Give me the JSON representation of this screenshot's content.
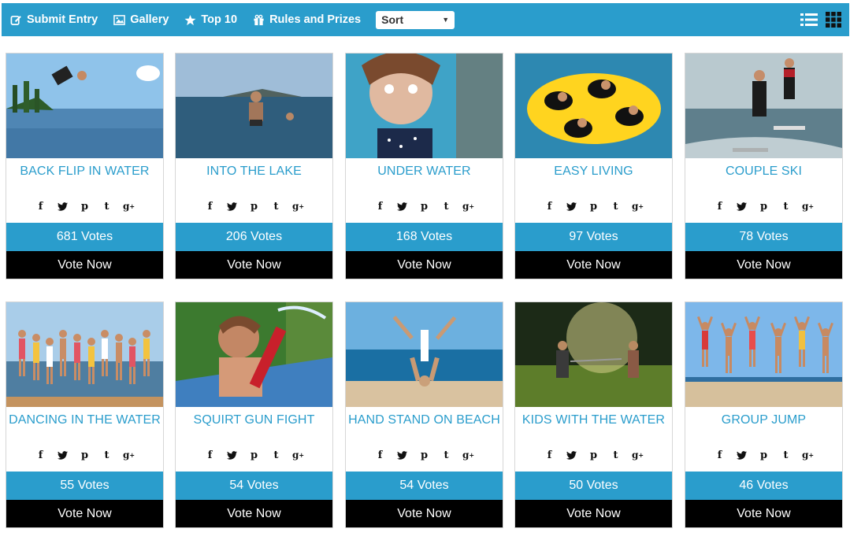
{
  "toolbar": {
    "submit_entry": "Submit Entry",
    "gallery": "Gallery",
    "top10": "Top 10",
    "rules": "Rules and Prizes",
    "sort_value": "Sort",
    "colors": {
      "bar": "#2a9dcc",
      "vote_now": "#000000"
    }
  },
  "entries": [
    {
      "title": "BACK FLIP IN WATER",
      "votes": "681 Votes",
      "cta": "Vote Now",
      "image": "sky-lake-flip"
    },
    {
      "title": "INTO THE LAKE",
      "votes": "206 Votes",
      "cta": "Vote Now",
      "image": "lake-jump"
    },
    {
      "title": "UNDER WATER",
      "votes": "168 Votes",
      "cta": "Vote Now",
      "image": "underwater-girl"
    },
    {
      "title": "EASY LIVING",
      "votes": "97 Votes",
      "cta": "Vote Now",
      "image": "yellow-float"
    },
    {
      "title": "COUPLE SKI",
      "votes": "78 Votes",
      "cta": "Vote Now",
      "image": "kitesurf"
    },
    {
      "title": "DANCING IN THE WATER",
      "votes": "55 Votes",
      "cta": "Vote Now",
      "image": "group-dancing"
    },
    {
      "title": "SQUIRT GUN FIGHT",
      "votes": "54 Votes",
      "cta": "Vote Now",
      "image": "squirt-gun"
    },
    {
      "title": "HAND STAND ON BEACH",
      "votes": "54 Votes",
      "cta": "Vote Now",
      "image": "beach-handstand"
    },
    {
      "title": "KIDS WITH THE WATER",
      "votes": "50 Votes",
      "cta": "Vote Now",
      "image": "sprinkler-kids"
    },
    {
      "title": "GROUP JUMP",
      "votes": "46 Votes",
      "cta": "Vote Now",
      "image": "beach-group-jump"
    }
  ],
  "social_icons": [
    "facebook-icon",
    "twitter-icon",
    "pinterest-icon",
    "tumblr-icon",
    "google-plus-icon"
  ]
}
